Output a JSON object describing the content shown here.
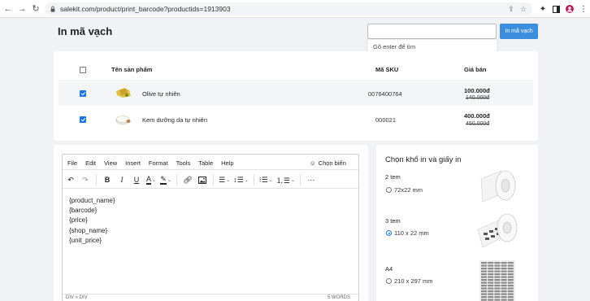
{
  "browser": {
    "url": "salekit.com/product/print_barcode?productids=1913903"
  },
  "page": {
    "title": "In mã vạch",
    "search_placeholder": "",
    "search_button": "In mã vạch",
    "search_hint": "Gõ enter để tìm"
  },
  "table": {
    "headers": {
      "name": "Tên sản phẩm",
      "sku": "Mã SKU",
      "price": "Giá bán"
    },
    "rows": [
      {
        "name": "Olive tự nhiên",
        "sku": "0076400764",
        "price": "100.000đ",
        "old_price": "140.000đ",
        "checked": true
      },
      {
        "name": "Kem dưỡng da tự nhiên",
        "sku": "000021",
        "price": "400.000đ",
        "old_price": "450.000đ",
        "checked": true
      }
    ]
  },
  "editor": {
    "menu": [
      "File",
      "Edit",
      "View",
      "Insert",
      "Format",
      "Tools",
      "Table",
      "Help"
    ],
    "choose_variable": "Chọn biến",
    "content": [
      "{product_name}",
      "{barcode}",
      "{price}",
      "{shop_name}",
      "{unit_price}"
    ],
    "status_left": "DIV » DIV",
    "status_right": "5 WORDS"
  },
  "paper": {
    "title": "Chọn khổ in và giấy in",
    "options": [
      {
        "label": "2 tem",
        "size": "72x22 mm",
        "selected": false
      },
      {
        "label": "3 tem",
        "size": "110 x 22 mm",
        "selected": true
      },
      {
        "label": "A4",
        "size": "210 x 297 mm",
        "selected": false
      }
    ]
  },
  "colors": {
    "primary": "#3c8dde",
    "checkbox": "#1a73e8"
  }
}
